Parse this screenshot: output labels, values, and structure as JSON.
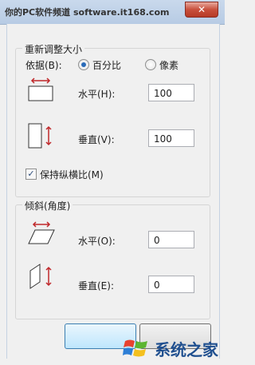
{
  "window": {
    "title": "你的PC软件频道 software.it168.com"
  },
  "resize": {
    "group_title": "重新调整大小",
    "by_label": "依据(B):",
    "options": [
      "百分比",
      "像素"
    ],
    "selected": "百分比",
    "horizontal_label": "水平(H):",
    "horizontal_value": "100",
    "vertical_label": "垂直(V):",
    "vertical_value": "100",
    "keep_ratio_label": "保持纵横比(M)",
    "keep_ratio_checked": true
  },
  "skew": {
    "group_title": "倾斜(角度)",
    "horizontal_label": "水平(O):",
    "horizontal_value": "0",
    "vertical_label": "垂直(E):",
    "vertical_value": "0"
  },
  "watermark": {
    "text": "系统之家"
  },
  "colors": {
    "arrow": "#c0282b",
    "accent": "#2a6bb8"
  }
}
